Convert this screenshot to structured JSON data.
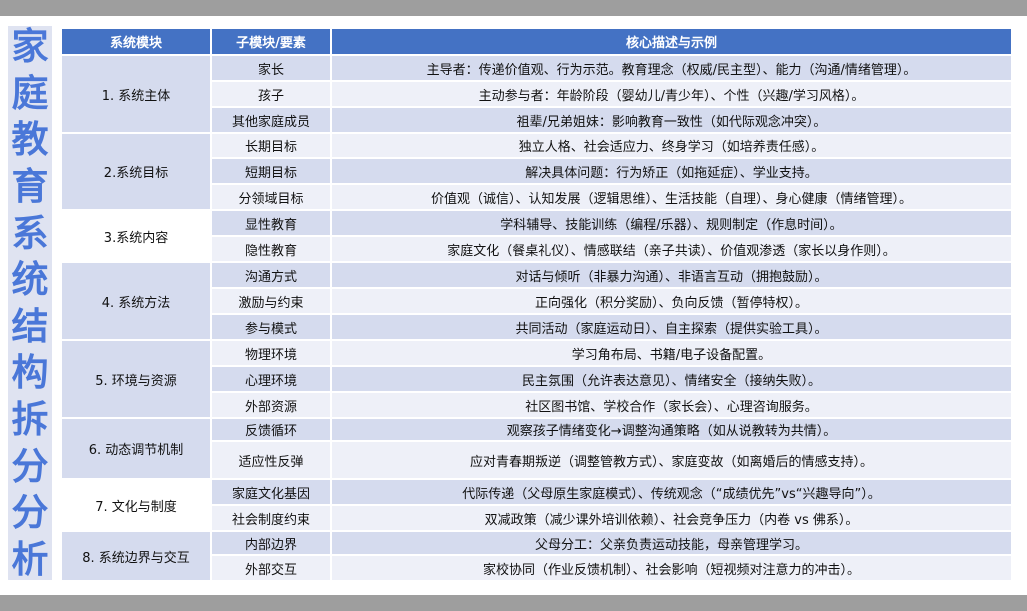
{
  "side_title": [
    "家",
    "庭",
    "教",
    "育",
    "系",
    "统",
    "结",
    "构",
    "拆",
    "分",
    "分",
    "析"
  ],
  "headers": [
    "系统模块",
    "子模块/要素",
    "核心描述与示例"
  ],
  "groups": [
    {
      "module": "1. 系统主体",
      "rows": [
        {
          "sub": "家长",
          "desc": "主导者：传递价值观、行为示范。教育理念（权威/民主型）、能力（沟通/情绪管理）。"
        },
        {
          "sub": "孩子",
          "desc": "主动参与者：年龄阶段（婴幼儿/青少年）、个性（兴趣/学习风格）。"
        },
        {
          "sub": "其他家庭成员",
          "desc": "祖辈/兄弟姐妹：影响教育一致性（如代际观念冲突）。"
        }
      ]
    },
    {
      "module": "2.系统目标",
      "rows": [
        {
          "sub": "长期目标",
          "desc": "独立人格、社会适应力、终身学习（如培养责任感）。"
        },
        {
          "sub": "短期目标",
          "desc": "解决具体问题：行为矫正（如拖延症）、学业支持。"
        },
        {
          "sub": "分领域目标",
          "desc": "价值观（诚信）、认知发展（逻辑思维）、生活技能（自理）、身心健康（情绪管理）。"
        }
      ]
    },
    {
      "module": "3.系统内容",
      "rows": [
        {
          "sub": "显性教育",
          "desc": "学科辅导、技能训练（编程/乐器）、规则制定（作息时间）。"
        },
        {
          "sub": "隐性教育",
          "desc": "家庭文化（餐桌礼仪）、情感联结（亲子共读）、价值观渗透（家长以身作则）。"
        }
      ]
    },
    {
      "module": "4. 系统方法",
      "rows": [
        {
          "sub": "沟通方式",
          "desc": "对话与倾听（非暴力沟通）、非语言互动（拥抱鼓励）。"
        },
        {
          "sub": "激励与约束",
          "desc": "正向强化（积分奖励）、负向反馈（暂停特权）。"
        },
        {
          "sub": "参与模式",
          "desc": "共同活动（家庭运动日）、自主探索（提供实验工具）。"
        }
      ]
    },
    {
      "module": "5. 环境与资源",
      "rows": [
        {
          "sub": "物理环境",
          "desc": "学习角布局、书籍/电子设备配置。"
        },
        {
          "sub": "心理环境",
          "desc": "民主氛围（允许表达意见）、情绪安全（接纳失败）。"
        },
        {
          "sub": "外部资源",
          "desc": "社区图书馆、学校合作（家长会）、心理咨询服务。"
        }
      ]
    },
    {
      "module": "6. 动态调节机制",
      "rows": [
        {
          "sub": "反馈循环",
          "desc": "观察孩子情绪变化→调整沟通策略（如从说教转为共情）。"
        },
        {
          "sub": "适应性反弹",
          "desc": "应对青春期叛逆（调整管教方式）、家庭变故（如离婚后的情感支持）。"
        }
      ]
    },
    {
      "module": "7. 文化与制度",
      "rows": [
        {
          "sub": "家庭文化基因",
          "desc": "代际传递（父母原生家庭模式）、传统观念（“成绩优先”vs“兴趣导向”）。"
        },
        {
          "sub": "社会制度约束",
          "desc": "双减政策（减少课外培训依赖）、社会竞争压力（内卷 vs 佛系）。"
        }
      ]
    },
    {
      "module": "8. 系统边界与交互",
      "rows": [
        {
          "sub": "内部边界",
          "desc": "父母分工：父亲负责运动技能，母亲管理学习。"
        },
        {
          "sub": "外部交互",
          "desc": "家校协同（作业反馈机制）、社会影响（短视频对注意力的冲击）。"
        }
      ]
    }
  ]
}
